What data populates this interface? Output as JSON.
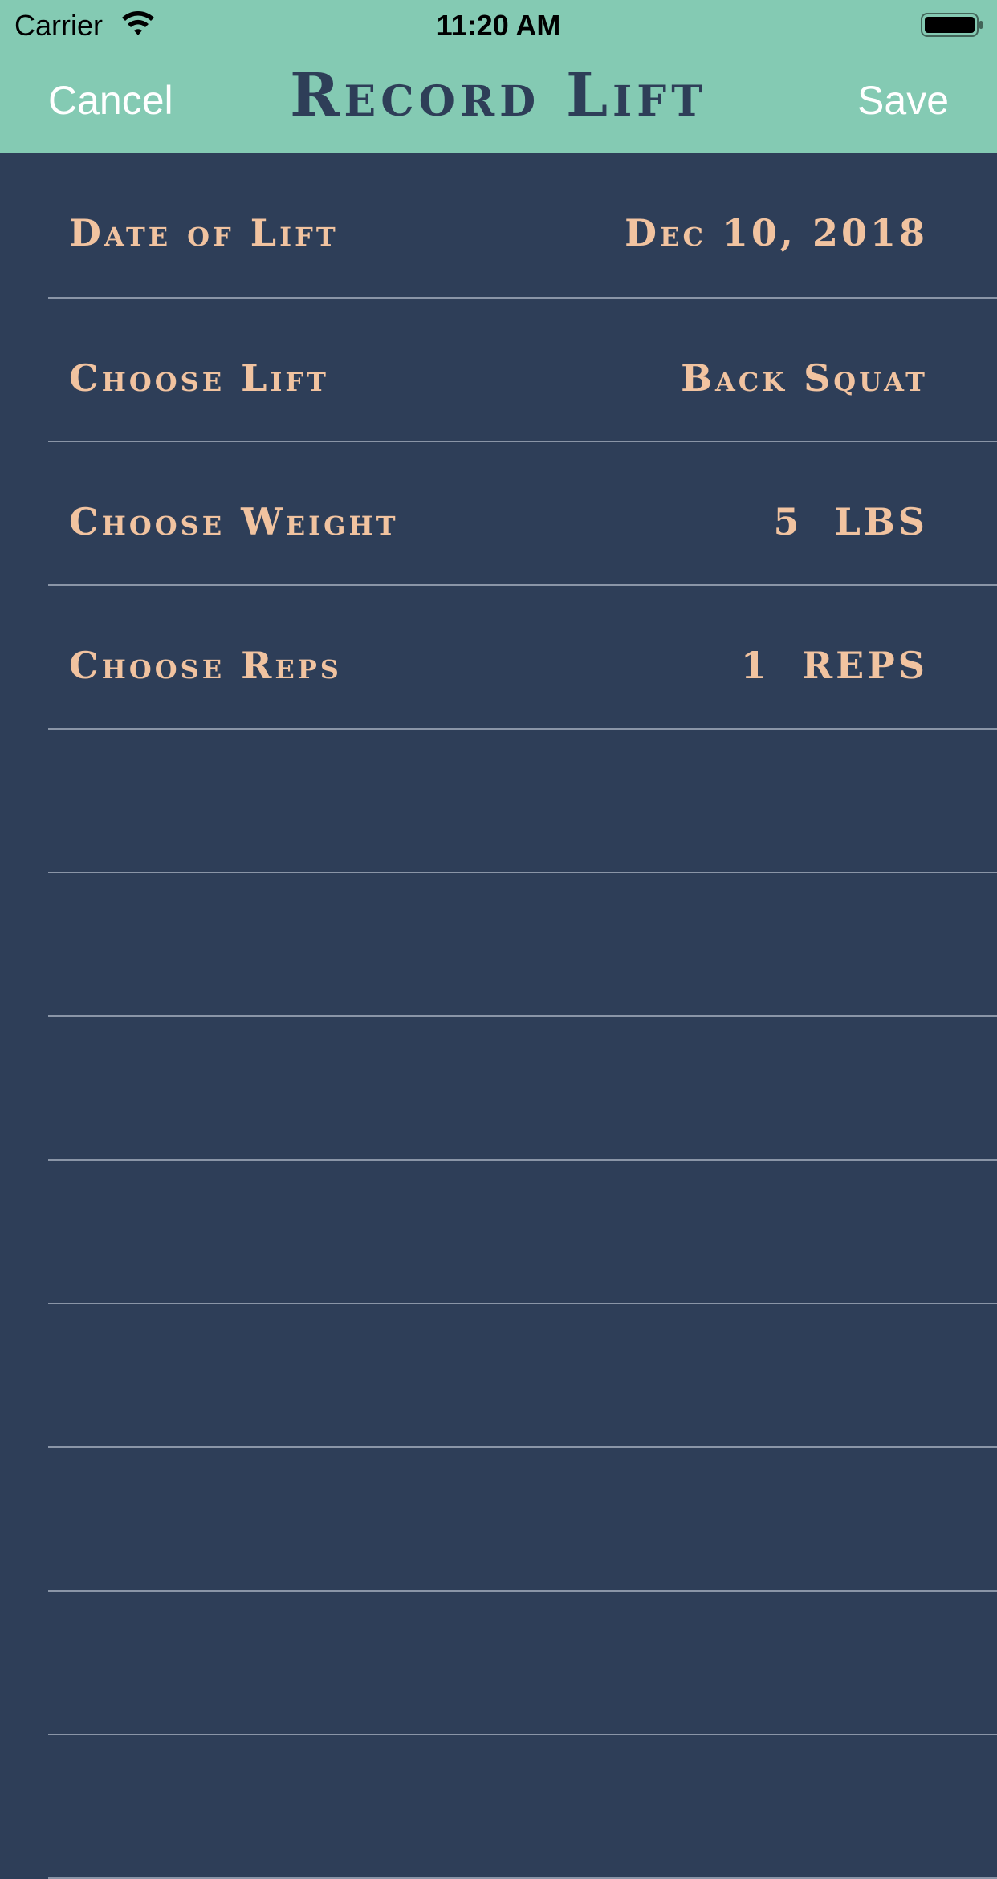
{
  "status_bar": {
    "carrier": "Carrier",
    "time": "11:20 AM",
    "wifi_icon": "wifi-icon",
    "battery_icon": "battery-icon"
  },
  "nav": {
    "cancel_label": "Cancel",
    "title": "Record Lift",
    "save_label": "Save"
  },
  "form": {
    "rows": [
      {
        "label": "Date of Lift",
        "value": "Dec 10, 2018"
      },
      {
        "label": "Choose Lift",
        "value": "Back Squat"
      },
      {
        "label": "Choose Weight",
        "value": "5  LBS"
      },
      {
        "label": "Choose Reps",
        "value": "1  REPS"
      }
    ]
  },
  "colors": {
    "header_bg": "#84cab3",
    "body_bg": "#2e3e58",
    "accent_text": "#f1c3a0",
    "separator": "#8a95a7"
  }
}
